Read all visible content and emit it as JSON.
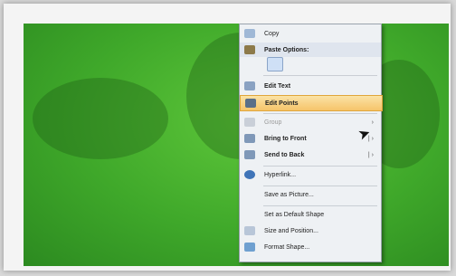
{
  "menu": {
    "copy": "Copy",
    "paste_options": "Paste Options:",
    "edit_text": "Edit Text",
    "edit_points": "Edit Points",
    "group": "Group",
    "bring_to_front": "Bring to Front",
    "send_to_back": "Send to Back",
    "hyperlink": "Hyperlink...",
    "save_as_picture": "Save as Picture...",
    "set_default_shape": "Set as Default Shape",
    "size_position": "Size and Position...",
    "format_shape": "Format Shape..."
  },
  "icons": {
    "copy": "copy-icon",
    "paste": "clipboard-icon",
    "edit_text": "text-box-icon",
    "edit_points": "edit-points-icon",
    "group": "group-icon",
    "bring_to_front": "bring-forward-icon",
    "send_to_back": "send-backward-icon",
    "hyperlink": "globe-link-icon",
    "size_position": "size-icon",
    "format_shape": "paint-icon"
  },
  "colors": {
    "background_green": "#3fa82a",
    "menu_bg": "#eef1f4",
    "highlight": "#f6c46a"
  }
}
